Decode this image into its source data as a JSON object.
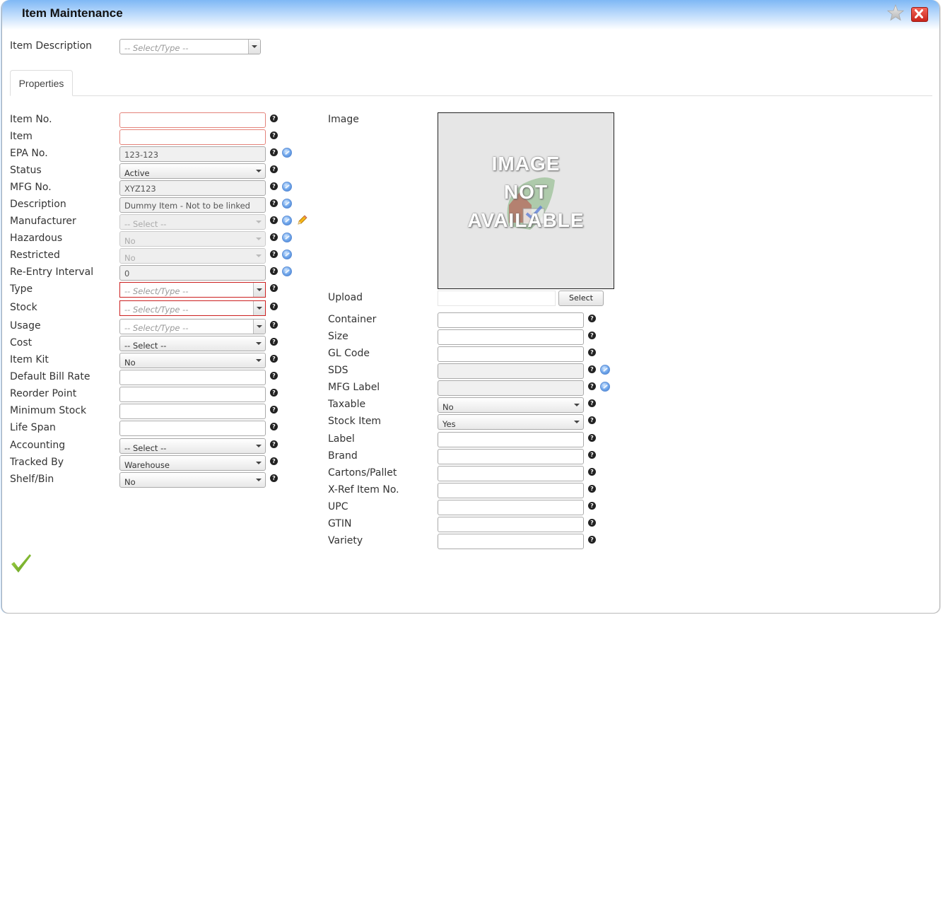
{
  "window": {
    "title": "Item Maintenance",
    "favorite_icon": "star-icon",
    "close_icon": "close-icon"
  },
  "header": {
    "item_description_label": "Item Description",
    "item_description_placeholder": "-- Select/Type --"
  },
  "tabs": [
    {
      "label": "Properties",
      "active": true
    }
  ],
  "left_fields": [
    {
      "label": "Item No.",
      "kind": "text",
      "value": "",
      "required": true,
      "help": true
    },
    {
      "label": "Item",
      "kind": "text",
      "value": "",
      "required": true,
      "help": true
    },
    {
      "label": "EPA No.",
      "kind": "readonly",
      "value": "123-123",
      "help": true,
      "globe": true
    },
    {
      "label": "Status",
      "kind": "select",
      "value": "Active",
      "help": true
    },
    {
      "label": "MFG No.",
      "kind": "readonly",
      "value": "XYZ123",
      "help": true,
      "globe": true
    },
    {
      "label": "Description",
      "kind": "readonly",
      "value": "Dummy Item - Not to be linked",
      "help": true,
      "globe": true
    },
    {
      "label": "Manufacturer",
      "kind": "disabled-select",
      "value": "-- Select --",
      "help": true,
      "globe": true,
      "edit": true
    },
    {
      "label": "Hazardous",
      "kind": "disabled-select",
      "value": "No",
      "help": true,
      "globe": true
    },
    {
      "label": "Restricted",
      "kind": "disabled-select",
      "value": "No",
      "help": true,
      "globe": true
    },
    {
      "label": "Re-Entry Interval",
      "kind": "readonly",
      "value": "0",
      "help": true,
      "globe": true
    },
    {
      "label": "Type",
      "kind": "combo",
      "value": "-- Select/Type --",
      "required": true,
      "help": true
    },
    {
      "label": "Stock",
      "kind": "combo",
      "value": "-- Select/Type --",
      "required": true,
      "help": true
    },
    {
      "label": "Usage",
      "kind": "combo",
      "value": "-- Select/Type --",
      "help": true
    },
    {
      "label": "Cost",
      "kind": "select",
      "value": "-- Select --",
      "help": true
    },
    {
      "label": "Item Kit",
      "kind": "select",
      "value": "No",
      "help": true
    },
    {
      "label": "Default Bill Rate",
      "kind": "text",
      "value": "",
      "help": true
    },
    {
      "label": "Reorder Point",
      "kind": "text",
      "value": "",
      "help": true
    },
    {
      "label": "Minimum Stock",
      "kind": "text",
      "value": "",
      "help": true
    },
    {
      "label": "Life Span",
      "kind": "text",
      "value": "",
      "help": true
    },
    {
      "label": "Accounting",
      "kind": "select",
      "value": "-- Select --",
      "help": true
    },
    {
      "label": "Tracked By",
      "kind": "select",
      "value": "Warehouse",
      "help": true
    },
    {
      "label": "Shelf/Bin",
      "kind": "select",
      "value": "No",
      "help": true
    }
  ],
  "image": {
    "label": "Image",
    "placeholder_lines": [
      "IMAGE",
      "NOT",
      "AVAILABLE"
    ],
    "upload_label": "Upload",
    "select_button": "Select"
  },
  "right_fields": [
    {
      "label": "Container",
      "kind": "text",
      "value": "",
      "help": true
    },
    {
      "label": "Size",
      "kind": "text",
      "value": "",
      "help": true
    },
    {
      "label": "GL Code",
      "kind": "text",
      "value": "",
      "help": true
    },
    {
      "label": "SDS",
      "kind": "readonly",
      "value": "",
      "help": true,
      "globe": true
    },
    {
      "label": "MFG Label",
      "kind": "readonly",
      "value": "",
      "help": true,
      "globe": true
    },
    {
      "label": "Taxable",
      "kind": "select",
      "value": "No",
      "help": true
    },
    {
      "label": "Stock Item",
      "kind": "select",
      "value": "Yes",
      "help": true
    },
    {
      "label": "Label",
      "kind": "text",
      "value": "",
      "help": true
    },
    {
      "label": "Brand",
      "kind": "text",
      "value": "",
      "help": true
    },
    {
      "label": "Cartons/Pallet",
      "kind": "text",
      "value": "",
      "help": true
    },
    {
      "label": "X-Ref Item No.",
      "kind": "text",
      "value": "",
      "help": true
    },
    {
      "label": "UPC",
      "kind": "text",
      "value": "",
      "help": true
    },
    {
      "label": "GTIN",
      "kind": "text",
      "value": "",
      "help": true
    },
    {
      "label": "Variety",
      "kind": "text",
      "value": "",
      "help": true
    }
  ],
  "actions": {
    "save_icon": "checkmark-icon"
  },
  "colors": {
    "title_gradient_top": "#7fb8f5",
    "required_border": "#e4837a",
    "required_combo_border": "#cc2020",
    "checkmark": "#7ab527",
    "close_button": "#d9342a"
  }
}
